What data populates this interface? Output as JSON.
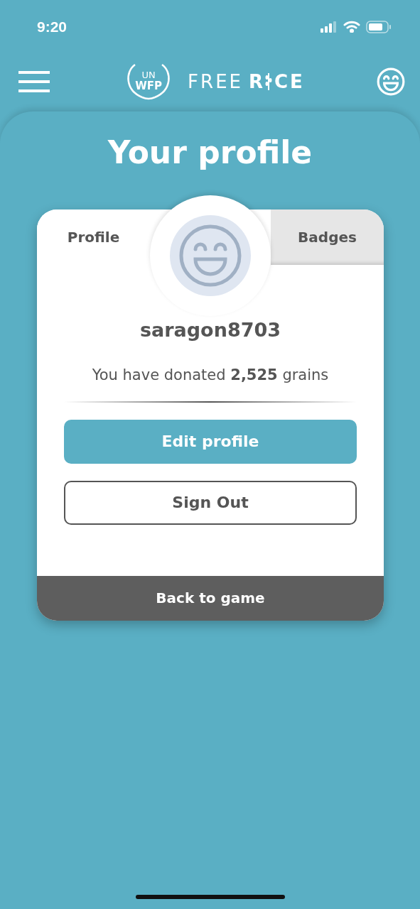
{
  "status_bar": {
    "time": "9:20"
  },
  "header": {
    "logo": {
      "emblem_top": "UN",
      "emblem_bottom": "WFP",
      "word_left": "FREE",
      "word_right_start": "R",
      "word_right_end": "CE"
    }
  },
  "title": "Your profile",
  "tabs": [
    {
      "label": "Profile",
      "selected": true
    },
    {
      "label": "Badges",
      "selected": false
    }
  ],
  "profile": {
    "username": "saragon8703",
    "donation": "You have donated **2,525** grains"
  },
  "buttons": [
    {
      "label": "Edit profile",
      "kind": "primary"
    },
    {
      "label": "Sign Out",
      "kind": "outline"
    }
  ],
  "footer": {
    "label": "Back to game"
  }
}
